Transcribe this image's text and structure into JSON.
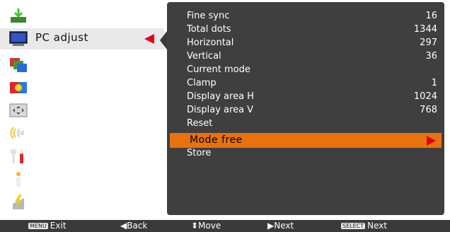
{
  "menu": {
    "items": [
      {
        "label": "Input",
        "icon": "input-icon"
      },
      {
        "label": "PC adjust",
        "icon": "pc-adjust-icon",
        "selected": true
      },
      {
        "label": "Image select",
        "icon": "image-select-icon"
      },
      {
        "label": "Image adjust",
        "icon": "image-adjust-icon"
      },
      {
        "label": "Screen",
        "icon": "screen-icon"
      },
      {
        "label": "Sound",
        "icon": "sound-icon"
      },
      {
        "label": "Setting",
        "icon": "setting-icon"
      },
      {
        "label": "Information",
        "icon": "information-icon"
      },
      {
        "label": "Network",
        "icon": "network-icon"
      }
    ]
  },
  "panel": {
    "rows": [
      {
        "label": "Fine sync",
        "value": "16"
      },
      {
        "label": "Total dots",
        "value": "1344"
      },
      {
        "label": "Horizontal",
        "value": "297"
      },
      {
        "label": "Vertical",
        "value": "36"
      },
      {
        "label": "Current mode",
        "value": ""
      },
      {
        "label": "Clamp",
        "value": "1"
      },
      {
        "label": "Display area H",
        "value": "1024"
      },
      {
        "label": "Display area V",
        "value": "768"
      },
      {
        "label": "Reset",
        "value": ""
      }
    ],
    "highlighted": {
      "label": "Mode free"
    },
    "after": [
      {
        "label": "Store",
        "value": ""
      }
    ]
  },
  "help": {
    "exit_key": "MENU",
    "exit": "Exit",
    "back": "◀Back",
    "move": "⬍Move",
    "next": "▶Next",
    "select_key": "SELECT",
    "select_next": "Next"
  },
  "colors": {
    "highlight": "#e8730c",
    "accent_red": "#e4001b",
    "panel": "#3f3f3f"
  }
}
